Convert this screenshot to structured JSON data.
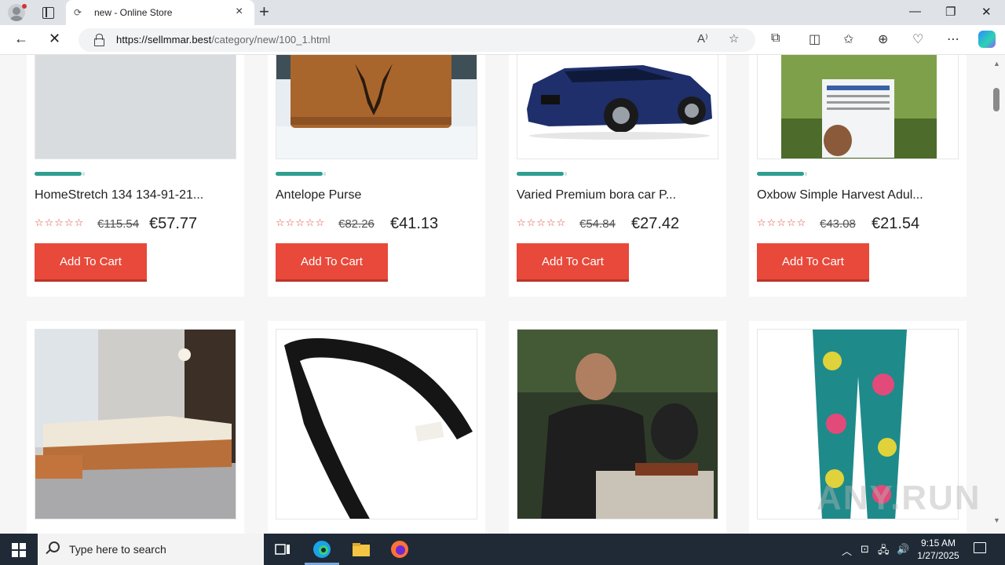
{
  "browser": {
    "tab_title": "new - Online Store",
    "url_domain": "https://sellmmar.best",
    "url_path": "/category/new/100_1.html"
  },
  "products": [
    {
      "name": "HomeStretch 134 134-91-21...",
      "old_price": "€115.54",
      "price": "€57.77",
      "rating": "☆☆☆☆☆",
      "cart_label": "Add To Cart",
      "image": "placeholder-gray"
    },
    {
      "name": "Antelope Purse",
      "old_price": "€82.26",
      "price": "€41.13",
      "rating": "☆☆☆☆☆",
      "cart_label": "Add To Cart",
      "image": "leather-purse-in-snow"
    },
    {
      "name": "Varied Premium bora car P...",
      "old_price": "€54.84",
      "price": "€27.42",
      "rating": "☆☆☆☆☆",
      "cart_label": "Add To Cart",
      "image": "blue-car"
    },
    {
      "name": "Oxbow Simple Harvest Adul...",
      "old_price": "€43.08",
      "price": "€21.54",
      "rating": "☆☆☆☆☆",
      "cart_label": "Add To Cart",
      "image": "rabbit-food-bag"
    },
    {
      "image": "living-room-sofa"
    },
    {
      "image": "black-guitar-strap"
    },
    {
      "image": "man-grilling"
    },
    {
      "image": "patterned-pajama-pants"
    }
  ],
  "taskbar": {
    "search_placeholder": "Type here to search",
    "time": "9:15 AM",
    "date": "1/27/2025"
  },
  "colors": {
    "cart_button": "#e8493a",
    "accent_bar": "#2e9e8f",
    "star": "#e24c3c"
  }
}
